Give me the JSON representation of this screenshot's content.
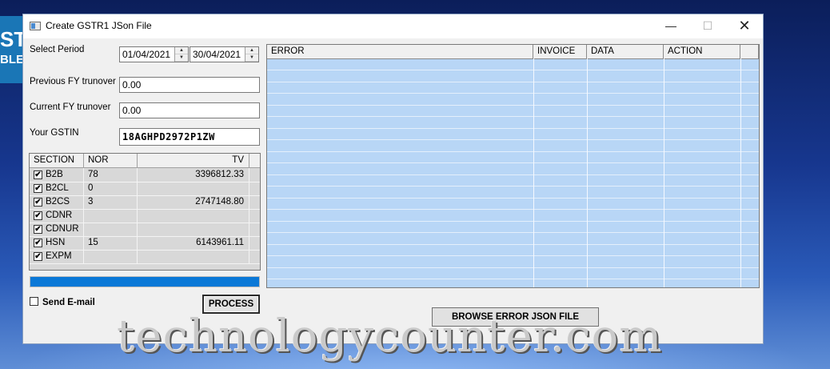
{
  "background": {
    "logo_line1": "ST",
    "logo_line2": "BLED",
    "accent": "#1a76b6"
  },
  "window": {
    "title": "Create GSTR1 JSon File",
    "minimize_icon": "minimize-icon",
    "maximize_icon": "maximize-icon",
    "close_icon": "close-icon"
  },
  "form": {
    "select_period_label": "Select Period",
    "from_date": "01/04/2021",
    "to_date": "30/04/2021",
    "prev_fy_label": "Previous FY trunover",
    "prev_fy_value": "0.00",
    "curr_fy_label": "Current FY trunover",
    "curr_fy_value": "0.00",
    "gstin_label": "Your GSTIN",
    "gstin_value": "18AGHPD2972P1ZW"
  },
  "section_table": {
    "headers": {
      "section": "SECTION",
      "nor": "NOR",
      "tv": "TV"
    },
    "rows": [
      {
        "section": "B2B",
        "nor": "78",
        "tv": "3396812.33",
        "checked": true
      },
      {
        "section": "B2CL",
        "nor": "0",
        "tv": "",
        "checked": true
      },
      {
        "section": "B2CS",
        "nor": "3",
        "tv": "2747148.80",
        "checked": true
      },
      {
        "section": "CDNR",
        "nor": "",
        "tv": "",
        "checked": true
      },
      {
        "section": "CDNUR",
        "nor": "",
        "tv": "",
        "checked": true
      },
      {
        "section": "HSN",
        "nor": "15",
        "tv": "6143961.11",
        "checked": true
      },
      {
        "section": "EXPM",
        "nor": "",
        "tv": "",
        "checked": true
      }
    ]
  },
  "progress": {
    "value": 1.0,
    "color": "#0a78d7"
  },
  "send_email": {
    "label": "Send E-mail",
    "checked": false
  },
  "buttons": {
    "process": "PROCESS",
    "browse": "BROWSE ERROR JSON FILE"
  },
  "error_table": {
    "headers": {
      "error": "ERROR",
      "invoice": "INVOICE",
      "data": "DATA",
      "action": "ACTION"
    },
    "row_color": "#b8d6f6"
  },
  "watermark": "technologycounter.com"
}
